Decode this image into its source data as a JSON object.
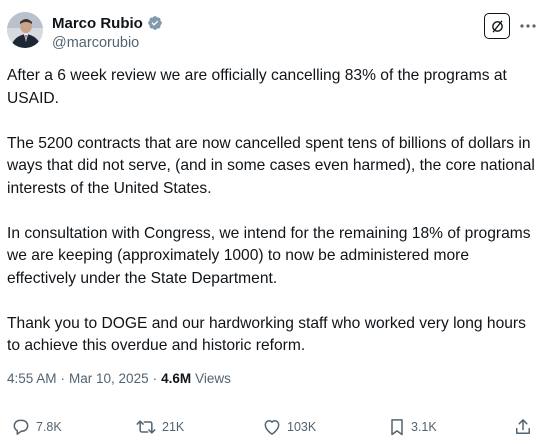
{
  "author": {
    "display_name": "Marco Rubio",
    "handle": "@marcorubio",
    "verified": true,
    "verified_color": "#829aab"
  },
  "tweet": {
    "text": "After a 6 week review we are officially cancelling  83%  of the programs at USAID.\n\nThe 5200 contracts that are now cancelled spent tens of billions of dollars in ways that did not serve, (and in some cases even harmed), the core national interests of the United States.\n\nIn consultation with Congress, we intend for the remaining 18% of programs we are keeping (approximately 1000) to now be administered more effectively under the State Department.\n\nThank you to DOGE and our hardworking staff who worked very long hours to achieve this overdue and historic reform.",
    "time": "4:55 AM",
    "separator": "·",
    "date": "Mar 10, 2025",
    "views_count": "4.6M",
    "views_label": "Views"
  },
  "actions": {
    "replies": "7.8K",
    "reposts": "21K",
    "likes": "103K",
    "bookmarks": "3.1K"
  },
  "icons": {
    "avatar": "avatar-photo",
    "verified": "verified-badge-icon",
    "grok": "grok-icon",
    "more": "more-icon",
    "reply": "reply-icon",
    "repost": "repost-icon",
    "like": "heart-icon",
    "bookmark": "bookmark-icon",
    "share": "share-icon"
  },
  "colors": {
    "text_primary": "#0f1419",
    "text_secondary": "#536471"
  }
}
